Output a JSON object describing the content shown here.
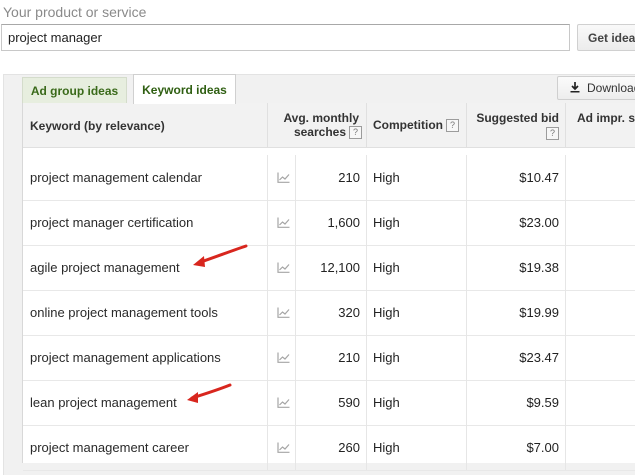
{
  "search": {
    "label": "Your product or service",
    "value": "project manager",
    "button_label": "Get ideas"
  },
  "tabs": [
    {
      "label": "Ad group ideas",
      "active": false
    },
    {
      "label": "Keyword ideas",
      "active": true
    }
  ],
  "download_label": "Download",
  "table": {
    "headers": {
      "keyword": "Keyword (by relevance)",
      "searches_line1": "Avg. monthly",
      "searches_line2": "searches",
      "competition": "Competition",
      "bid": "Suggested bid",
      "impr": "Ad impr. sh"
    },
    "help_glyph": "?",
    "rows": [
      {
        "keyword": "project management calendar",
        "searches": "210",
        "competition": "High",
        "bid": "$10.47"
      },
      {
        "keyword": "project manager certification",
        "searches": "1,600",
        "competition": "High",
        "bid": "$23.00"
      },
      {
        "keyword": "agile project management",
        "searches": "12,100",
        "competition": "High",
        "bid": "$19.38"
      },
      {
        "keyword": "online project management tools",
        "searches": "320",
        "competition": "High",
        "bid": "$19.99"
      },
      {
        "keyword": "project management applications",
        "searches": "210",
        "competition": "High",
        "bid": "$23.47"
      },
      {
        "keyword": "lean project management",
        "searches": "590",
        "competition": "High",
        "bid": "$9.59"
      },
      {
        "keyword": "project management career",
        "searches": "260",
        "competition": "High",
        "bid": "$7.00"
      }
    ]
  },
  "icons": {
    "download": "download-icon",
    "trend": "trend-chart-icon",
    "help": "help-icon",
    "annotation": "red-arrow-annotation"
  },
  "colors": {
    "tab_text": "#3a6a1a",
    "annotation": "#d8261e"
  }
}
